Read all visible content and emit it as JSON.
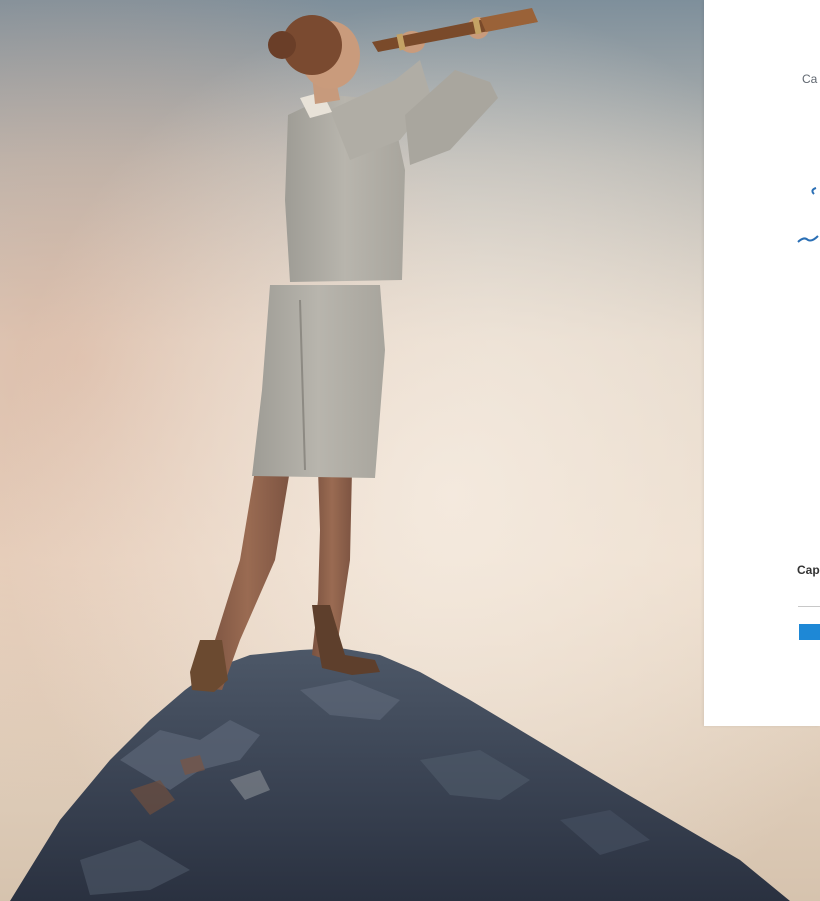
{
  "panel": {
    "caption_top": "Ca",
    "caption_bottom": "Cap",
    "accent_color": "#1e88d6",
    "text_color": "#606770"
  },
  "scene": {
    "subject": "woman-with-spyglass",
    "ground": "rock-peak"
  }
}
